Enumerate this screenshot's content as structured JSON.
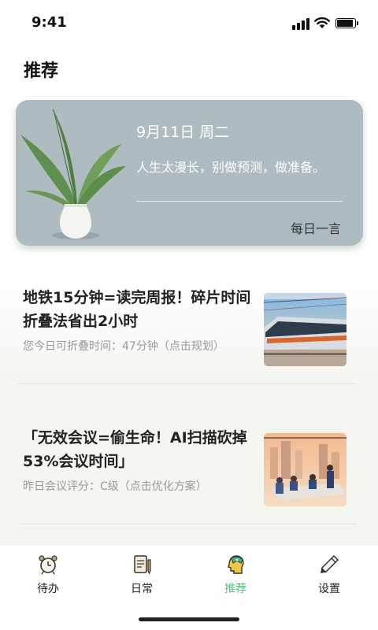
{
  "status_bar": {
    "time": "9:41"
  },
  "page": {
    "title": "推荐"
  },
  "quote_card": {
    "date": "9月11日 周二",
    "text": "人生太漫长，别做预测，做准备。",
    "tag": "每日一言"
  },
  "articles": [
    {
      "title": "地铁15分钟=读完周报！碎片时间折叠法省出2小时",
      "meta": "您今日可折叠时间：47分钟（点击规划）",
      "thumb": "subway-train-image"
    },
    {
      "title": "「无效会议=偷生命！AI扫描砍掉53%会议时间」",
      "meta": "昨日会议评分：C级（点击优化方案）",
      "thumb": "meeting-room-image"
    }
  ],
  "tabs": [
    {
      "label": "待办",
      "icon": "alarm-clock-icon",
      "active": false
    },
    {
      "label": "日常",
      "icon": "notepad-icon",
      "active": false
    },
    {
      "label": "推荐",
      "icon": "brain-head-icon",
      "active": true
    },
    {
      "label": "设置",
      "icon": "pencil-icon",
      "active": false
    }
  ],
  "colors": {
    "accent": "#52c27c",
    "card_bg": "#aebbbf"
  }
}
